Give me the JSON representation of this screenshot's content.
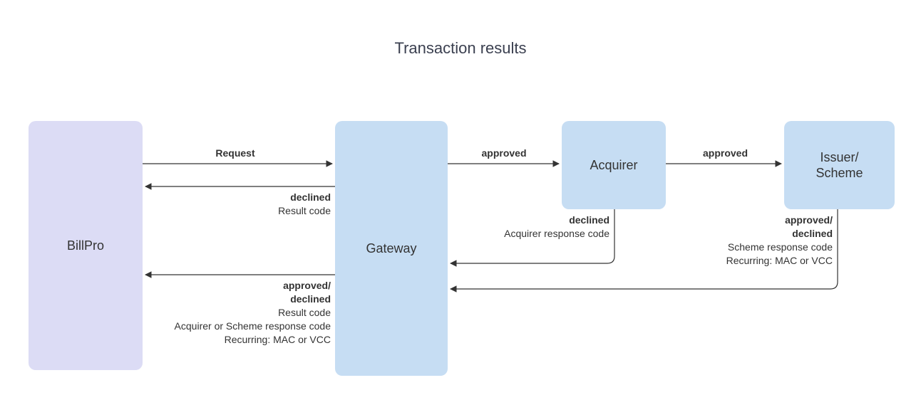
{
  "title": "Transaction results",
  "nodes": {
    "billpro": "BillPro",
    "gateway": "Gateway",
    "acquirer": "Acquirer",
    "issuer": "Issuer/\nScheme"
  },
  "edges": {
    "request": {
      "label": "Request"
    },
    "gw_acq_approved": {
      "label": "approved"
    },
    "acq_iss_approved": {
      "label": "approved"
    },
    "gw_bp_declined": {
      "status": "declined",
      "lines": [
        "Result code"
      ]
    },
    "acq_gw_declined": {
      "status": "declined",
      "lines": [
        "Acquirer response code"
      ]
    },
    "iss_gw": {
      "status": "approved/\ndeclined",
      "lines": [
        "Scheme response code",
        "Recurring: MAC or VCC"
      ]
    },
    "gw_bp_final": {
      "status": "approved/\ndeclined",
      "lines": [
        "Result code",
        "Acquirer or Scheme response code",
        "Recurring: MAC or VCC"
      ]
    }
  }
}
